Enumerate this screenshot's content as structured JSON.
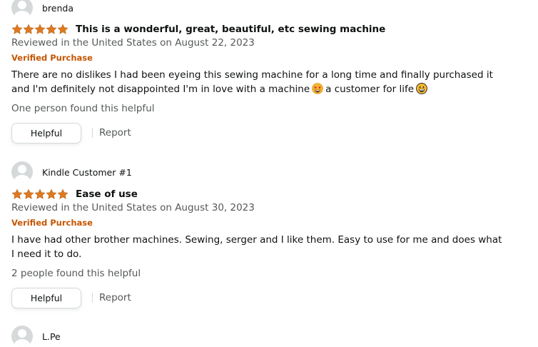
{
  "reviews": [
    {
      "profile_name": "brenda",
      "rating": 5,
      "title": "This is a wonderful, great, beautiful, etc sewing machine",
      "date": "Reviewed in the United States on August 22, 2023",
      "verified": "Verified Purchase",
      "body_part1": "There are no dislikes I had been eyeing this sewing machine for a long time and finally purchased it and I'm definitely not disappointed I'm in love with a machine",
      "body_emoji1": "star-struck-emoji",
      "body_part2": "a customer for life",
      "body_emoji2": "grinning-face-emoji",
      "helpful_count": "One person found this helpful",
      "helpful_label": "Helpful",
      "report_label": "Report"
    },
    {
      "profile_name": "Kindle Customer #1",
      "rating": 5,
      "title": "Ease of use",
      "date": "Reviewed in the United States on August 30, 2023",
      "verified": "Verified Purchase",
      "body": "I have had other brother machines. Sewing, serger and I like them. Easy to use for me and does what I need it to do.",
      "helpful_count": "2 people found this helpful",
      "helpful_label": "Helpful",
      "report_label": "Report"
    },
    {
      "profile_name": "L.Pe"
    }
  ],
  "colors": {
    "star": "#de7921",
    "verified": "#c45500",
    "secondary_text": "#565959",
    "avatar_bg": "#d5d9d9"
  }
}
